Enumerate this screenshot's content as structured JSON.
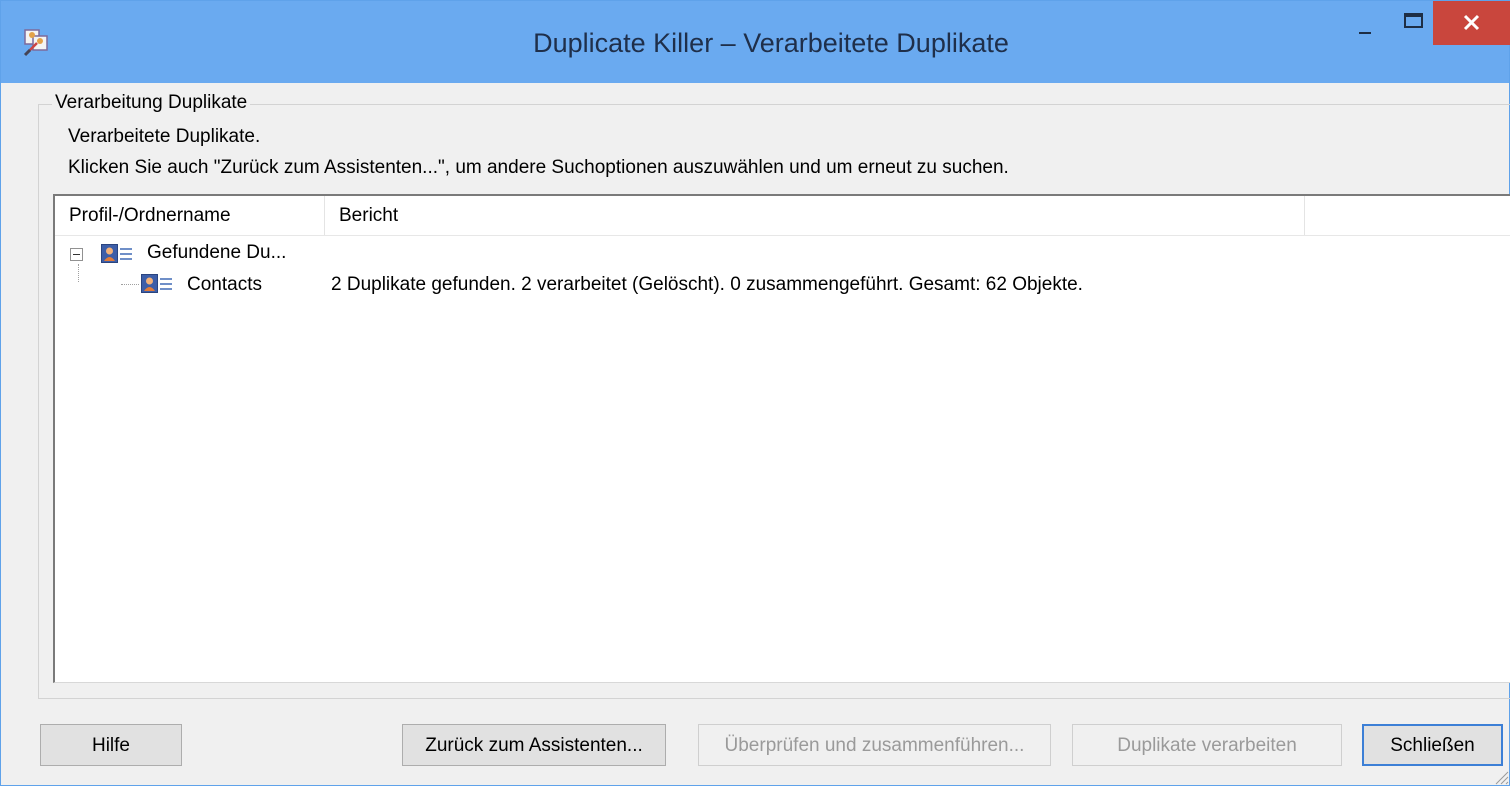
{
  "window": {
    "title": "Duplicate Killer – Verarbeitete Duplikate",
    "titlebar_color": "#6aaaf0",
    "close_button_color": "#c9463d",
    "buttons": {
      "minimize": "minimize-icon",
      "maximize": "maximize-icon",
      "close": "close-icon"
    }
  },
  "group": {
    "label": "Verarbeitung Duplikate",
    "line1": "Verarbeitete Duplikate.",
    "line2": "Klicken Sie auch \"Zurück zum Assistenten...\", um andere Suchoptionen auszuwählen und um erneut zu suchen."
  },
  "list": {
    "columns": [
      "Profil-/Ordnername",
      "Bericht"
    ],
    "rows": [
      {
        "name": "Gefundene Du...",
        "report": "",
        "expanded": true,
        "icon": "contact-card-icon"
      },
      {
        "name": "Contacts",
        "report": "2 Duplikate gefunden. 2 verarbeitet (Gelöscht). 0 zusammengeführt. Gesamt: 62 Objekte.",
        "icon": "contact-card-icon"
      }
    ]
  },
  "buttons": {
    "help": "Hilfe",
    "back": "Zurück zum Assistenten...",
    "review": "Überprüfen und zusammenführen...",
    "process": "Duplikate verarbeiten",
    "close": "Schließen"
  },
  "accent": "#3c7fd6"
}
